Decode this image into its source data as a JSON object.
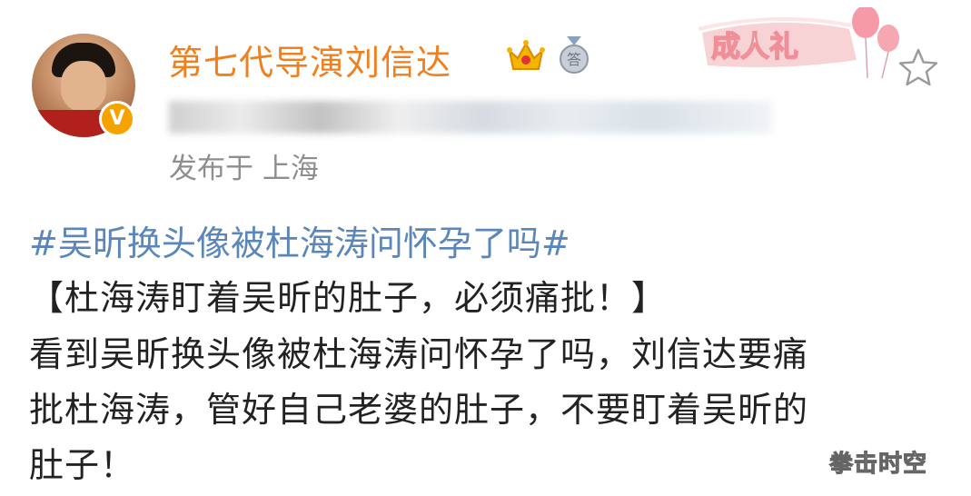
{
  "post": {
    "username": "第七代导演刘信达",
    "verified_badge": "V",
    "published": "发布于 上海",
    "ceremony_badge": "成人礼",
    "hashtag": "#吴昕换头像被杜海涛问怀孕了吗#",
    "lines": [
      "【杜海涛盯着吴昕的肚子，必须痛批！】",
      "看到吴昕换头像被杜海涛问怀孕了吗，刘信达要痛",
      "批杜海涛，管好自己老婆的肚子，不要盯着吴昕的",
      "肚子！"
    ]
  },
  "icons": {
    "crown": "crown-icon",
    "medal": "medal-icon",
    "star": "star-icon",
    "verified": "verified-v-icon"
  },
  "medal_char": "答",
  "watermark": "拳击时空",
  "colors": {
    "username": "#f07f1e",
    "hashtag": "#5b86b9",
    "text": "#222222",
    "meta": "#8e8e8e",
    "badge": "#f5a300"
  }
}
